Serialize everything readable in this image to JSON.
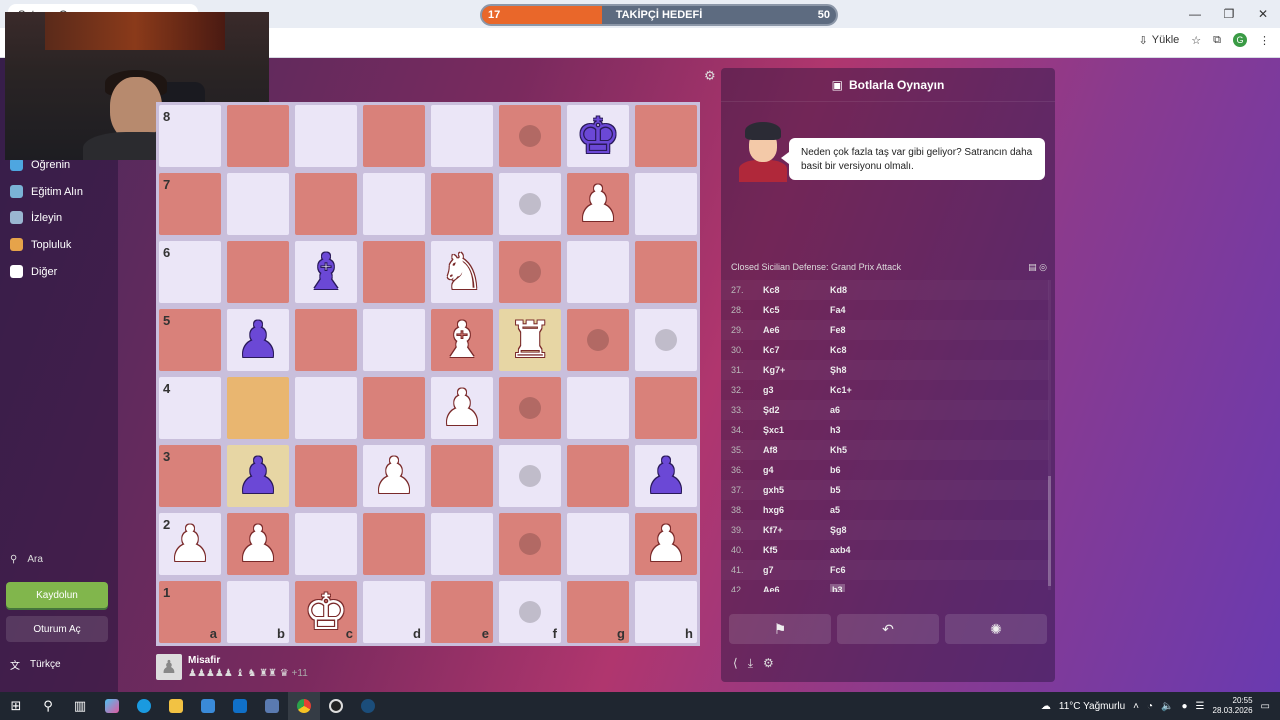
{
  "browser": {
    "tab_title": "Satranç Oynayın",
    "install_label": "Yükle"
  },
  "goal": {
    "current": "17",
    "label": "TAKİPÇİ HEDEFİ",
    "target": "50",
    "progress_fraction": 0.34
  },
  "sidebar": {
    "items": [
      {
        "label": "Öğrenin",
        "icon": "learn-icon",
        "color": "#4ea6e0"
      },
      {
        "label": "Eğitim Alın",
        "icon": "coach-icon",
        "color": "#7ab3d6"
      },
      {
        "label": "İzleyin",
        "icon": "binoculars-icon",
        "color": "#9ab6d2"
      },
      {
        "label": "Topluluk",
        "icon": "community-icon",
        "color": "#e6a34a"
      },
      {
        "label": "Diğer",
        "icon": "more-icon",
        "color": "#ffffff"
      }
    ],
    "search_label": "Ara",
    "signup_label": "Kaydolun",
    "login_label": "Oturum Aç",
    "language_label": "Türkçe"
  },
  "board": {
    "files": [
      "a",
      "b",
      "c",
      "d",
      "e",
      "f",
      "g",
      "h"
    ],
    "ranks": [
      "8",
      "7",
      "6",
      "5",
      "4",
      "3",
      "2",
      "1"
    ],
    "colors": {
      "light": "#ebe6f7",
      "dark": "#d9817a",
      "highlight": "#e7d6a4",
      "highlight_from": "#e9b670"
    },
    "pieces": [
      {
        "sq": "g8",
        "piece": "♚",
        "color": "b"
      },
      {
        "sq": "g7",
        "piece": "♟",
        "color": "w"
      },
      {
        "sq": "c6",
        "piece": "♝",
        "color": "b"
      },
      {
        "sq": "e6",
        "piece": "♞",
        "color": "w"
      },
      {
        "sq": "b5",
        "piece": "♟",
        "color": "b"
      },
      {
        "sq": "e5",
        "piece": "♝",
        "color": "w"
      },
      {
        "sq": "f5",
        "piece": "♜",
        "color": "w"
      },
      {
        "sq": "e4",
        "piece": "♟",
        "color": "w"
      },
      {
        "sq": "b3",
        "piece": "♟",
        "color": "b"
      },
      {
        "sq": "d3",
        "piece": "♟",
        "color": "w"
      },
      {
        "sq": "h3",
        "piece": "♟",
        "color": "b"
      },
      {
        "sq": "a2",
        "piece": "♟",
        "color": "w"
      },
      {
        "sq": "b2",
        "piece": "♟",
        "color": "w"
      },
      {
        "sq": "h2",
        "piece": "♟",
        "color": "w"
      },
      {
        "sq": "c1",
        "piece": "♚",
        "color": "w"
      }
    ],
    "dots": [
      "f8",
      "f7",
      "f6",
      "g5",
      "h5",
      "f4",
      "f3",
      "f2",
      "f1"
    ],
    "highlights": [
      "f5",
      "b3"
    ],
    "highlights_from": [
      "b4"
    ]
  },
  "player": {
    "name": "Misafir",
    "captured": "♟♟♟♟♟ ♝ ♞ ♜♜ ♛",
    "advantage": "+11"
  },
  "panel": {
    "title": "Botlarla Oynayın",
    "bubble_text": "Neden çok fazla taş var gibi geliyor? Satrancın daha basit bir versiyonu olmalı.",
    "opening": "Closed Sicilian Defense: Grand Prix Attack",
    "moves": [
      {
        "n": "27.",
        "w": "Kc8",
        "b": "Kd8"
      },
      {
        "n": "28.",
        "w": "Kc5",
        "b": "Fa4"
      },
      {
        "n": "29.",
        "w": "Ae6",
        "b": "Fe8"
      },
      {
        "n": "30.",
        "w": "Kc7",
        "b": "Kc8"
      },
      {
        "n": "31.",
        "w": "Kg7+",
        "b": "Şh8"
      },
      {
        "n": "32.",
        "w": "g3",
        "b": "Kc1+"
      },
      {
        "n": "33.",
        "w": "Şd2",
        "b": "a6"
      },
      {
        "n": "34.",
        "w": "Şxc1",
        "b": "h3"
      },
      {
        "n": "35.",
        "w": "Af8",
        "b": "Kh5"
      },
      {
        "n": "36.",
        "w": "g4",
        "b": "b6"
      },
      {
        "n": "37.",
        "w": "gxh5",
        "b": "b5"
      },
      {
        "n": "38.",
        "w": "hxg6",
        "b": "a5"
      },
      {
        "n": "39.",
        "w": "Kf7+",
        "b": "Şg8"
      },
      {
        "n": "40.",
        "w": "Kf5",
        "b": "axb4"
      },
      {
        "n": "41.",
        "w": "g7",
        "b": "Fc6"
      },
      {
        "n": "42.",
        "w": "Ae6",
        "b": "b3"
      }
    ],
    "actions": [
      "flag-icon",
      "undo-icon",
      "hint-icon"
    ]
  },
  "taskbar": {
    "weather": "11°C  Yağmurlu",
    "time": "20:55",
    "date": "28.03.2026"
  }
}
